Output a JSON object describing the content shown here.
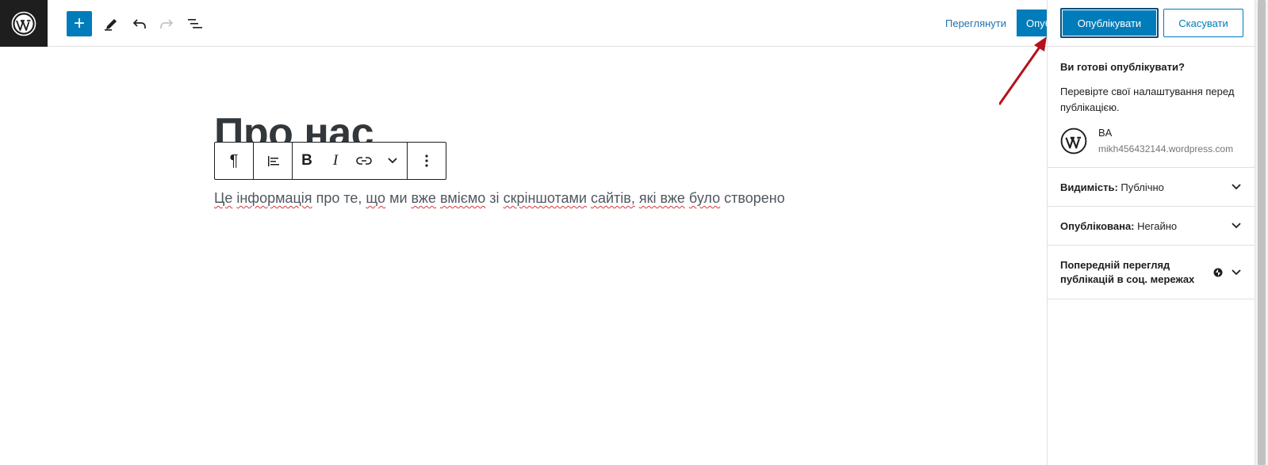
{
  "topbar": {
    "logo_icon": "wordpress-logo-icon",
    "tools": [
      "add-block-icon",
      "pencil-icon",
      "undo-icon",
      "redo-icon",
      "list-view-icon"
    ],
    "preview_label": "Переглянути",
    "publish_label": "Опублікувати"
  },
  "editor": {
    "title": "Про нас",
    "block_toolbar": [
      "paragraph-icon",
      "align-left-icon",
      "bold-icon",
      "italic-icon",
      "link-icon",
      "chevron-down-icon",
      "more-options-icon"
    ],
    "paragraph_words": [
      "Це",
      "інформація",
      "про те,",
      "що",
      "ми",
      "вже",
      "вміємо",
      "зі",
      "скріншотами",
      "сайтів,",
      "які вже",
      "було",
      "створено"
    ]
  },
  "publish_panel": {
    "publish_button": "Опублікувати",
    "cancel_button": "Скасувати",
    "ready_title": "Ви готові опублікувати?",
    "ready_description": "Перевірте свої налаштування перед публікацією.",
    "site_name": "BA",
    "site_url": "mikh456432144.wordpress.com",
    "visibility_label": "Видимість:",
    "visibility_value": "Публічно",
    "published_label": "Опублікована:",
    "published_value": "Негайно",
    "social_preview_label": "Попередній перегляд публікацій в соц. мережах"
  },
  "colors": {
    "accent": "#007cba",
    "dark": "#1e1e1e",
    "annotation_arrow": "#b3121b"
  }
}
